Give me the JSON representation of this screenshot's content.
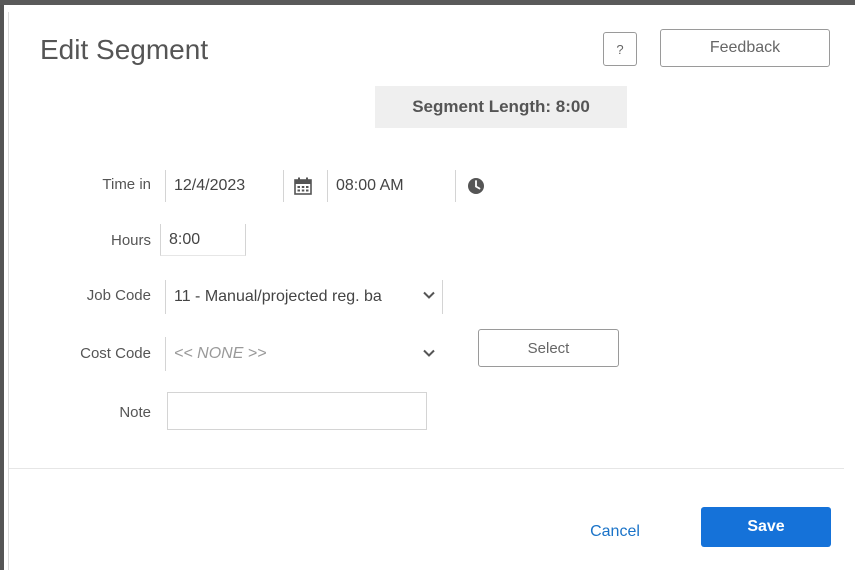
{
  "dialog": {
    "title": "Edit Segment",
    "help_label": "?",
    "feedback_label": "Feedback",
    "segment_length": "Segment Length: 8:00"
  },
  "form": {
    "time_in_label": "Time in",
    "date_value": "12/4/2023",
    "time_value": "08:00 AM",
    "hours_label": "Hours",
    "hours_value": "8:00",
    "job_code_label": "Job Code",
    "job_code_value": "11 - Manual/projected reg. ba",
    "cost_code_label": "Cost Code",
    "cost_code_value": "<< NONE >>",
    "select_label": "Select",
    "note_label": "Note",
    "note_value": ""
  },
  "footer": {
    "cancel_label": "Cancel",
    "save_label": "Save"
  },
  "icons": {
    "calendar": "calendar-icon",
    "clock": "clock-icon",
    "chevron": "chevron-down-icon"
  },
  "colors": {
    "primary": "#1572d9",
    "link": "#1a73c8"
  }
}
